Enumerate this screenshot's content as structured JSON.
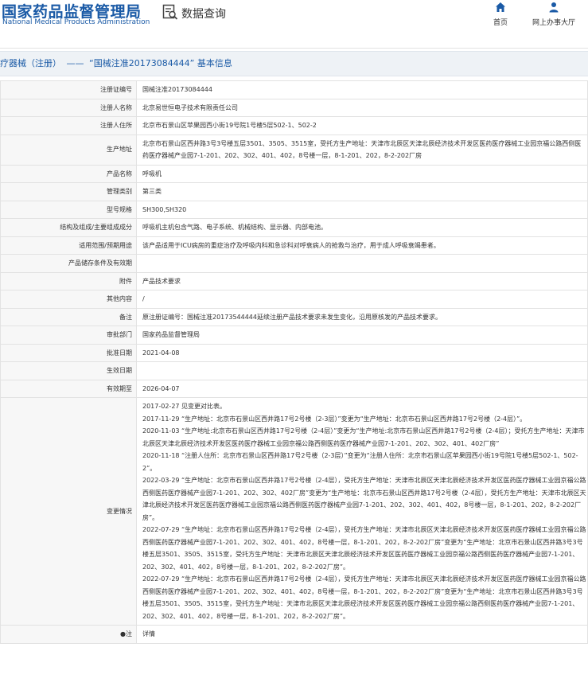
{
  "header": {
    "logo_cn": "国家药品监督管理局",
    "logo_en": "National Medical Products Administration",
    "query_title": "数据查询",
    "nav": [
      {
        "label": "首页",
        "icon": "home-icon"
      },
      {
        "label": "网上办事大厅",
        "icon": "user-icon"
      }
    ]
  },
  "breadcrumb": {
    "category": "疗器械（注册）",
    "separator": "——",
    "title": "“国械注准20173084444” 基本信息"
  },
  "colors": {
    "brand": "#1a5aa6",
    "label_bg": "#f7f7f7",
    "border": "#e2e2e2"
  },
  "rows": [
    {
      "label": "注册证编号",
      "value": "国械注准20173084444"
    },
    {
      "label": "注册人名称",
      "value": "北京易世恒电子技术有限责任公司"
    },
    {
      "label": "注册人住所",
      "value": "北京市石景山区苹果园西小街19号院1号楼5层502-1、502-2"
    },
    {
      "label": "生产地址",
      "value": "北京市石景山区西井路3号3号楼五层3501、3505、3515室，受托方生产地址：天津市北辰区天津北辰经济技术开发区医药医疗器械工业园京福公路西侧医药医疗器械产业园7-1-201、202、302、401、402，8号楼一层，8-1-201、202，8-2-202厂房"
    },
    {
      "label": "产品名称",
      "value": "呼吸机"
    },
    {
      "label": "管理类别",
      "value": "第三类"
    },
    {
      "label": "型号规格",
      "value": "SH300,SH320"
    },
    {
      "label": "结构及组成/主要组成成分",
      "value": "呼吸机主机包含气路、电子系统、机械结构、显示器、内部电池。"
    },
    {
      "label": "适用范围/预期用途",
      "value": "该产品适用于ICU病房的重症治疗及呼吸内科和急诊科对呼衰病人的抢救与治疗，用于成人呼吸衰竭患者。"
    },
    {
      "label": "产品储存条件及有效期",
      "value": ""
    },
    {
      "label": "附件",
      "value": "产品技术要求"
    },
    {
      "label": "其他内容",
      "value": "/"
    },
    {
      "label": "备注",
      "value": "原注册证编号：国械注准20173544444延续注册产品技术要求未发生变化，沿用原核发的产品技术要求。"
    },
    {
      "label": "审批部门",
      "value": "国家药品监督管理局"
    },
    {
      "label": "批准日期",
      "value": "2021-04-08"
    },
    {
      "label": "生效日期",
      "value": ""
    },
    {
      "label": "有效期至",
      "value": "2026-04-07"
    }
  ],
  "changes": {
    "label": "变更情况",
    "entries": [
      "2017-02-27 见变更对比表。",
      "2017-11-29 “生产地址：北京市石景山区西井路17号2号楼（2-3层）”变更为“生产地址：北京市石景山区西井路17号2号楼（2-4层）”。",
      "2020-11-03 “生产地址:北京市石景山区西井路17号2号楼（2-4层）”变更为“生产地址:北京市石景山区西井路17号2号楼（2-4层）；受托方生产地址：天津市北辰区天津北辰经济技术开发区医药医疗器械工业园京福公路西侧医药医疗器械产业园7-1-201、202、302、401、402厂房”",
      "2020-11-18 “注册人住所：北京市石景山区西井路17号2号楼（2-3层）”变更为“注册人住所：北京市石景山区苹果园西小街19号院1号楼5层502-1、502-2”。",
      "2022-03-29 “生产地址：北京市石景山区西井路17号2号楼（2-4层），受托方生产地址：天津市北辰区天津北辰经济技术开发区医药医疗器械工业园京福公路西侧医药医疗器械产业园7-1-201、202、302、402厂房”变更为“生产地址：北京市石景山区西井路17号2号楼（2-4层），受托方生产地址：天津市北辰区天津北辰经济技术开发区医药医疗器械工业园京福公路西侧医药医疗器械产业园7-1-201、202、302、401、402，8号楼一层，8-1-201、202，8-2-202厂房”。",
      "2022-07-29 “生产地址：北京市石景山区西井路17号2号楼（2-4层），受托方生产地址：天津市北辰区天津北辰经济技术开发区医药医疗器械工业园京福公路西侧医药医疗器械产业园7-1-201、202、302、401、402，8号楼一层，8-1-201、202，8-2-202厂房”变更为“生产地址：北京市石景山区西井路3号3号楼五层3501、3505、3515室，受托方生产地址：天津市北辰区天津北辰经济技术开发区医药医疗器械工业园京福公路西侧医药医疗器械产业园7-1-201、202、302、401、402，8号楼一层，8-1-201、202，8-2-202厂房”。",
      "2022-07-29 “生产地址：北京市石景山区西井路17号2号楼（2-4层），受托方生产地址：天津市北辰区天津北辰经济技术开发区医药医疗器械工业园京福公路西侧医药医疗器械产业园7-1-201、202、302、401、402，8号楼一层，8-1-201、202，8-2-202厂房”变更为“生产地址：北京市石景山区西井路3号3号楼五层3501、3505、3515室，受托方生产地址：天津市北辰区天津北辰经济技术开发区医药医疗器械工业园京福公路西侧医药医疗器械产业园7-1-201、202、302、401、402，8号楼一层，8-1-201、202，8-2-202厂房”。"
    ]
  },
  "note": {
    "label": "●注",
    "link": "详情"
  }
}
